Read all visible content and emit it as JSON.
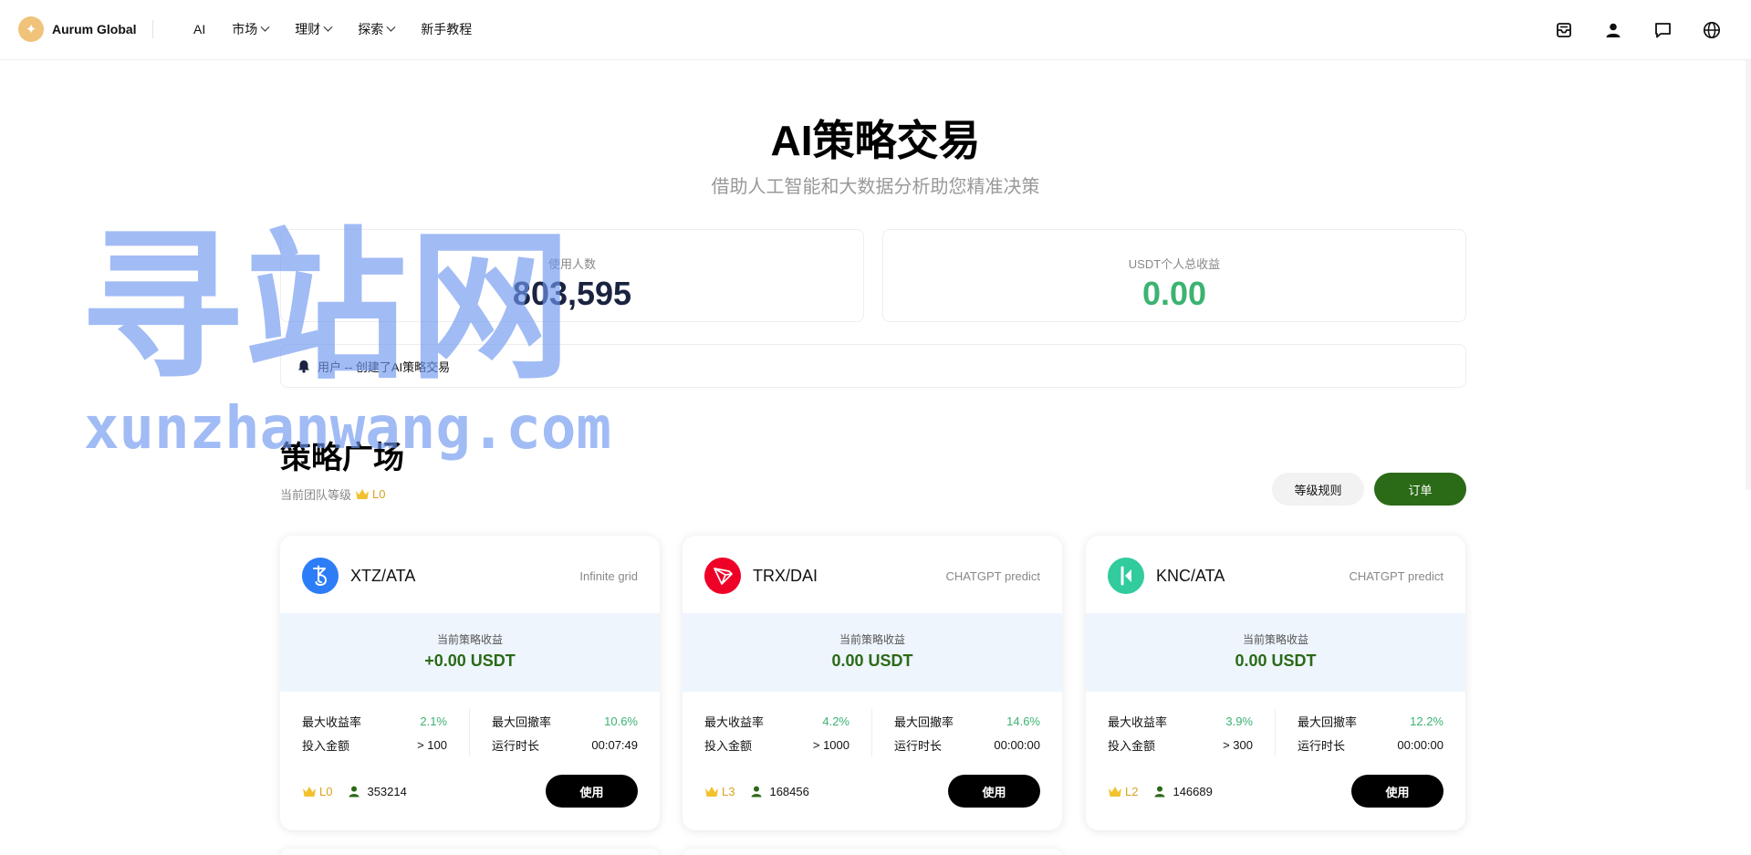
{
  "header": {
    "brand": "Aurum Global",
    "nav": [
      {
        "label": "AI",
        "dropdown": false
      },
      {
        "label": "市场",
        "dropdown": true
      },
      {
        "label": "理财",
        "dropdown": true
      },
      {
        "label": "探索",
        "dropdown": true
      },
      {
        "label": "新手教程",
        "dropdown": false
      }
    ],
    "icons": [
      "inbox-icon",
      "user-icon",
      "chat-icon",
      "globe-icon"
    ]
  },
  "hero": {
    "title": "AI策略交易",
    "subtitle": "借助人工智能和大数据分析助您精准决策"
  },
  "stats": {
    "users_label": "使用人数",
    "users_value": "803,595",
    "profit_label": "USDT个人总收益",
    "profit_value": "0.00"
  },
  "notice": {
    "text": "用户 -- 创建了AI策略交易"
  },
  "section": {
    "title": "策略广场",
    "team_level_label": "当前团队等级",
    "team_level": "L0",
    "rules_button": "等级规则",
    "orders_button": "订单"
  },
  "cards": [
    {
      "pair": "XTZ/ATA",
      "tag": "Infinite grid",
      "profit_label": "当前策略收益",
      "profit": "+0.00 USDT",
      "max_return_label": "最大收益率",
      "max_return": "2.1%",
      "max_drawdown_label": "最大回撤率",
      "max_drawdown": "10.6%",
      "invest_label": "投入金额",
      "invest": "> 100",
      "runtime_label": "运行时长",
      "runtime": "00:07:49",
      "level": "L0",
      "users": "353214",
      "button": "使用"
    },
    {
      "pair": "TRX/DAI",
      "tag": "CHATGPT predict",
      "profit_label": "当前策略收益",
      "profit": "0.00 USDT",
      "max_return_label": "最大收益率",
      "max_return": "4.2%",
      "max_drawdown_label": "最大回撤率",
      "max_drawdown": "14.6%",
      "invest_label": "投入金额",
      "invest": "> 1000",
      "runtime_label": "运行时长",
      "runtime": "00:00:00",
      "level": "L3",
      "users": "168456",
      "button": "使用"
    },
    {
      "pair": "KNC/ATA",
      "tag": "CHATGPT predict",
      "profit_label": "当前策略收益",
      "profit": "0.00 USDT",
      "max_return_label": "最大收益率",
      "max_return": "3.9%",
      "max_drawdown_label": "最大回撤率",
      "max_drawdown": "12.2%",
      "invest_label": "投入金额",
      "invest": "> 300",
      "runtime_label": "运行时长",
      "runtime": "00:00:00",
      "level": "L2",
      "users": "146689",
      "button": "使用"
    }
  ],
  "watermark": {
    "cn": "寻站网",
    "en": "xunzhanwang.com"
  },
  "colors": {
    "accent_green": "#2b6a17",
    "positive": "#3cb371",
    "crown": "#f2c12e",
    "xtz_coin": "#2c7df7",
    "trx_coin": "#ef0027",
    "knc_coin": "#31cb9e"
  }
}
